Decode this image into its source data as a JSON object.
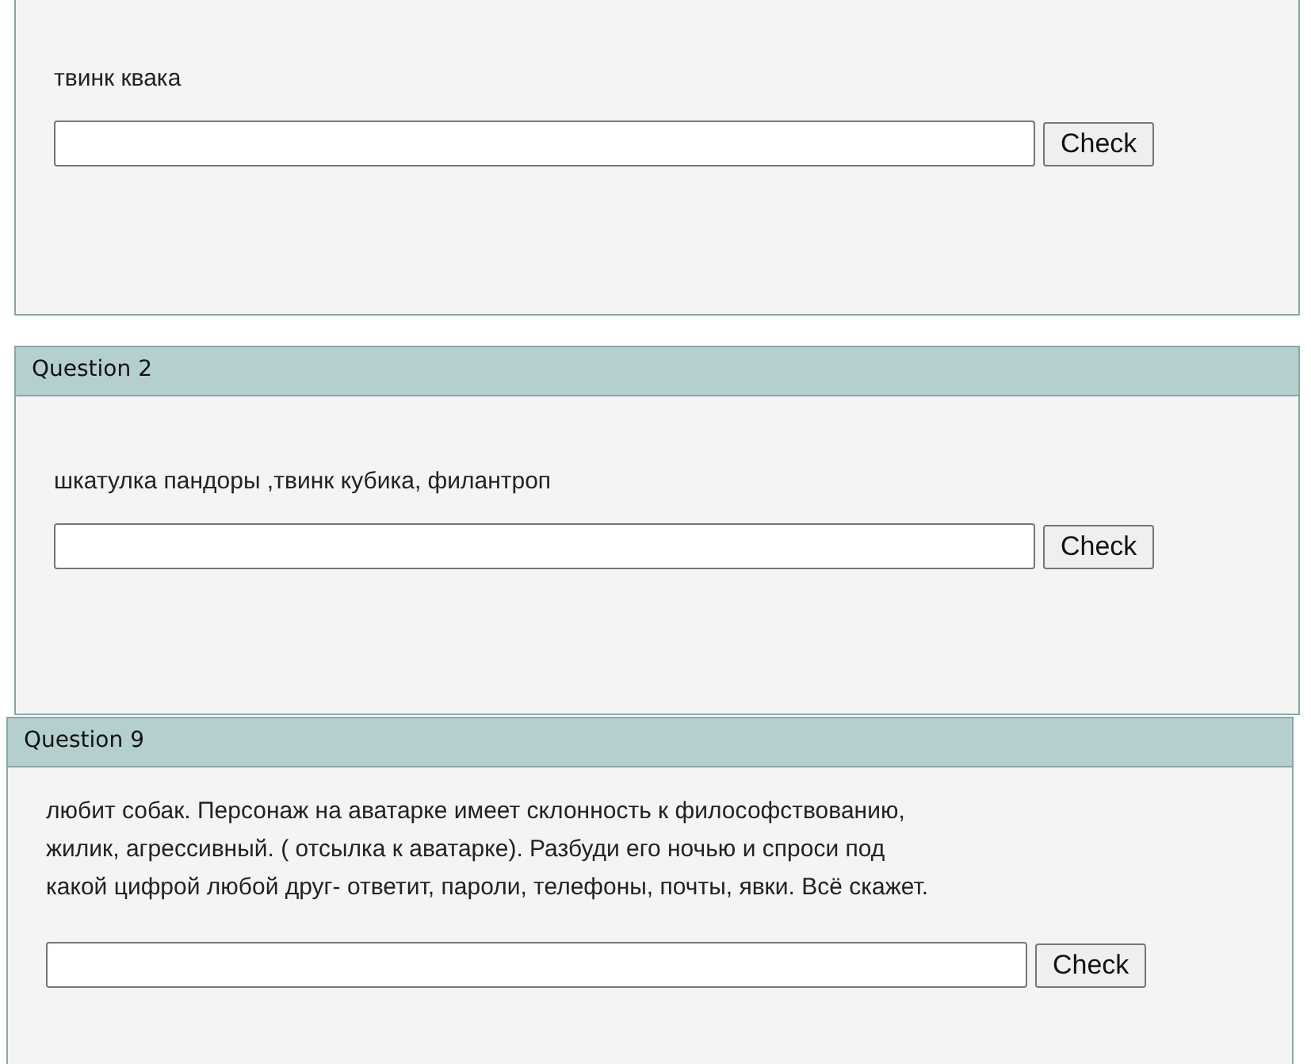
{
  "questions": [
    {
      "text": "твинк квака",
      "button": "Check"
    },
    {
      "title": "Question 2",
      "text": "шкатулка пандоры ,твинк кубика, филантроп",
      "button": "Check"
    },
    {
      "title": "Question 9",
      "text": "любит собак. Персонаж на аватарке имеет склонность к философствованию, жилик, агрессивный. ( отсылка к аватарке). Разбуди его ночью и спроси под какой цифрой любой друг- ответит, пароли, телефоны, почты, явки. Всё скажет.",
      "button": "Check"
    }
  ]
}
